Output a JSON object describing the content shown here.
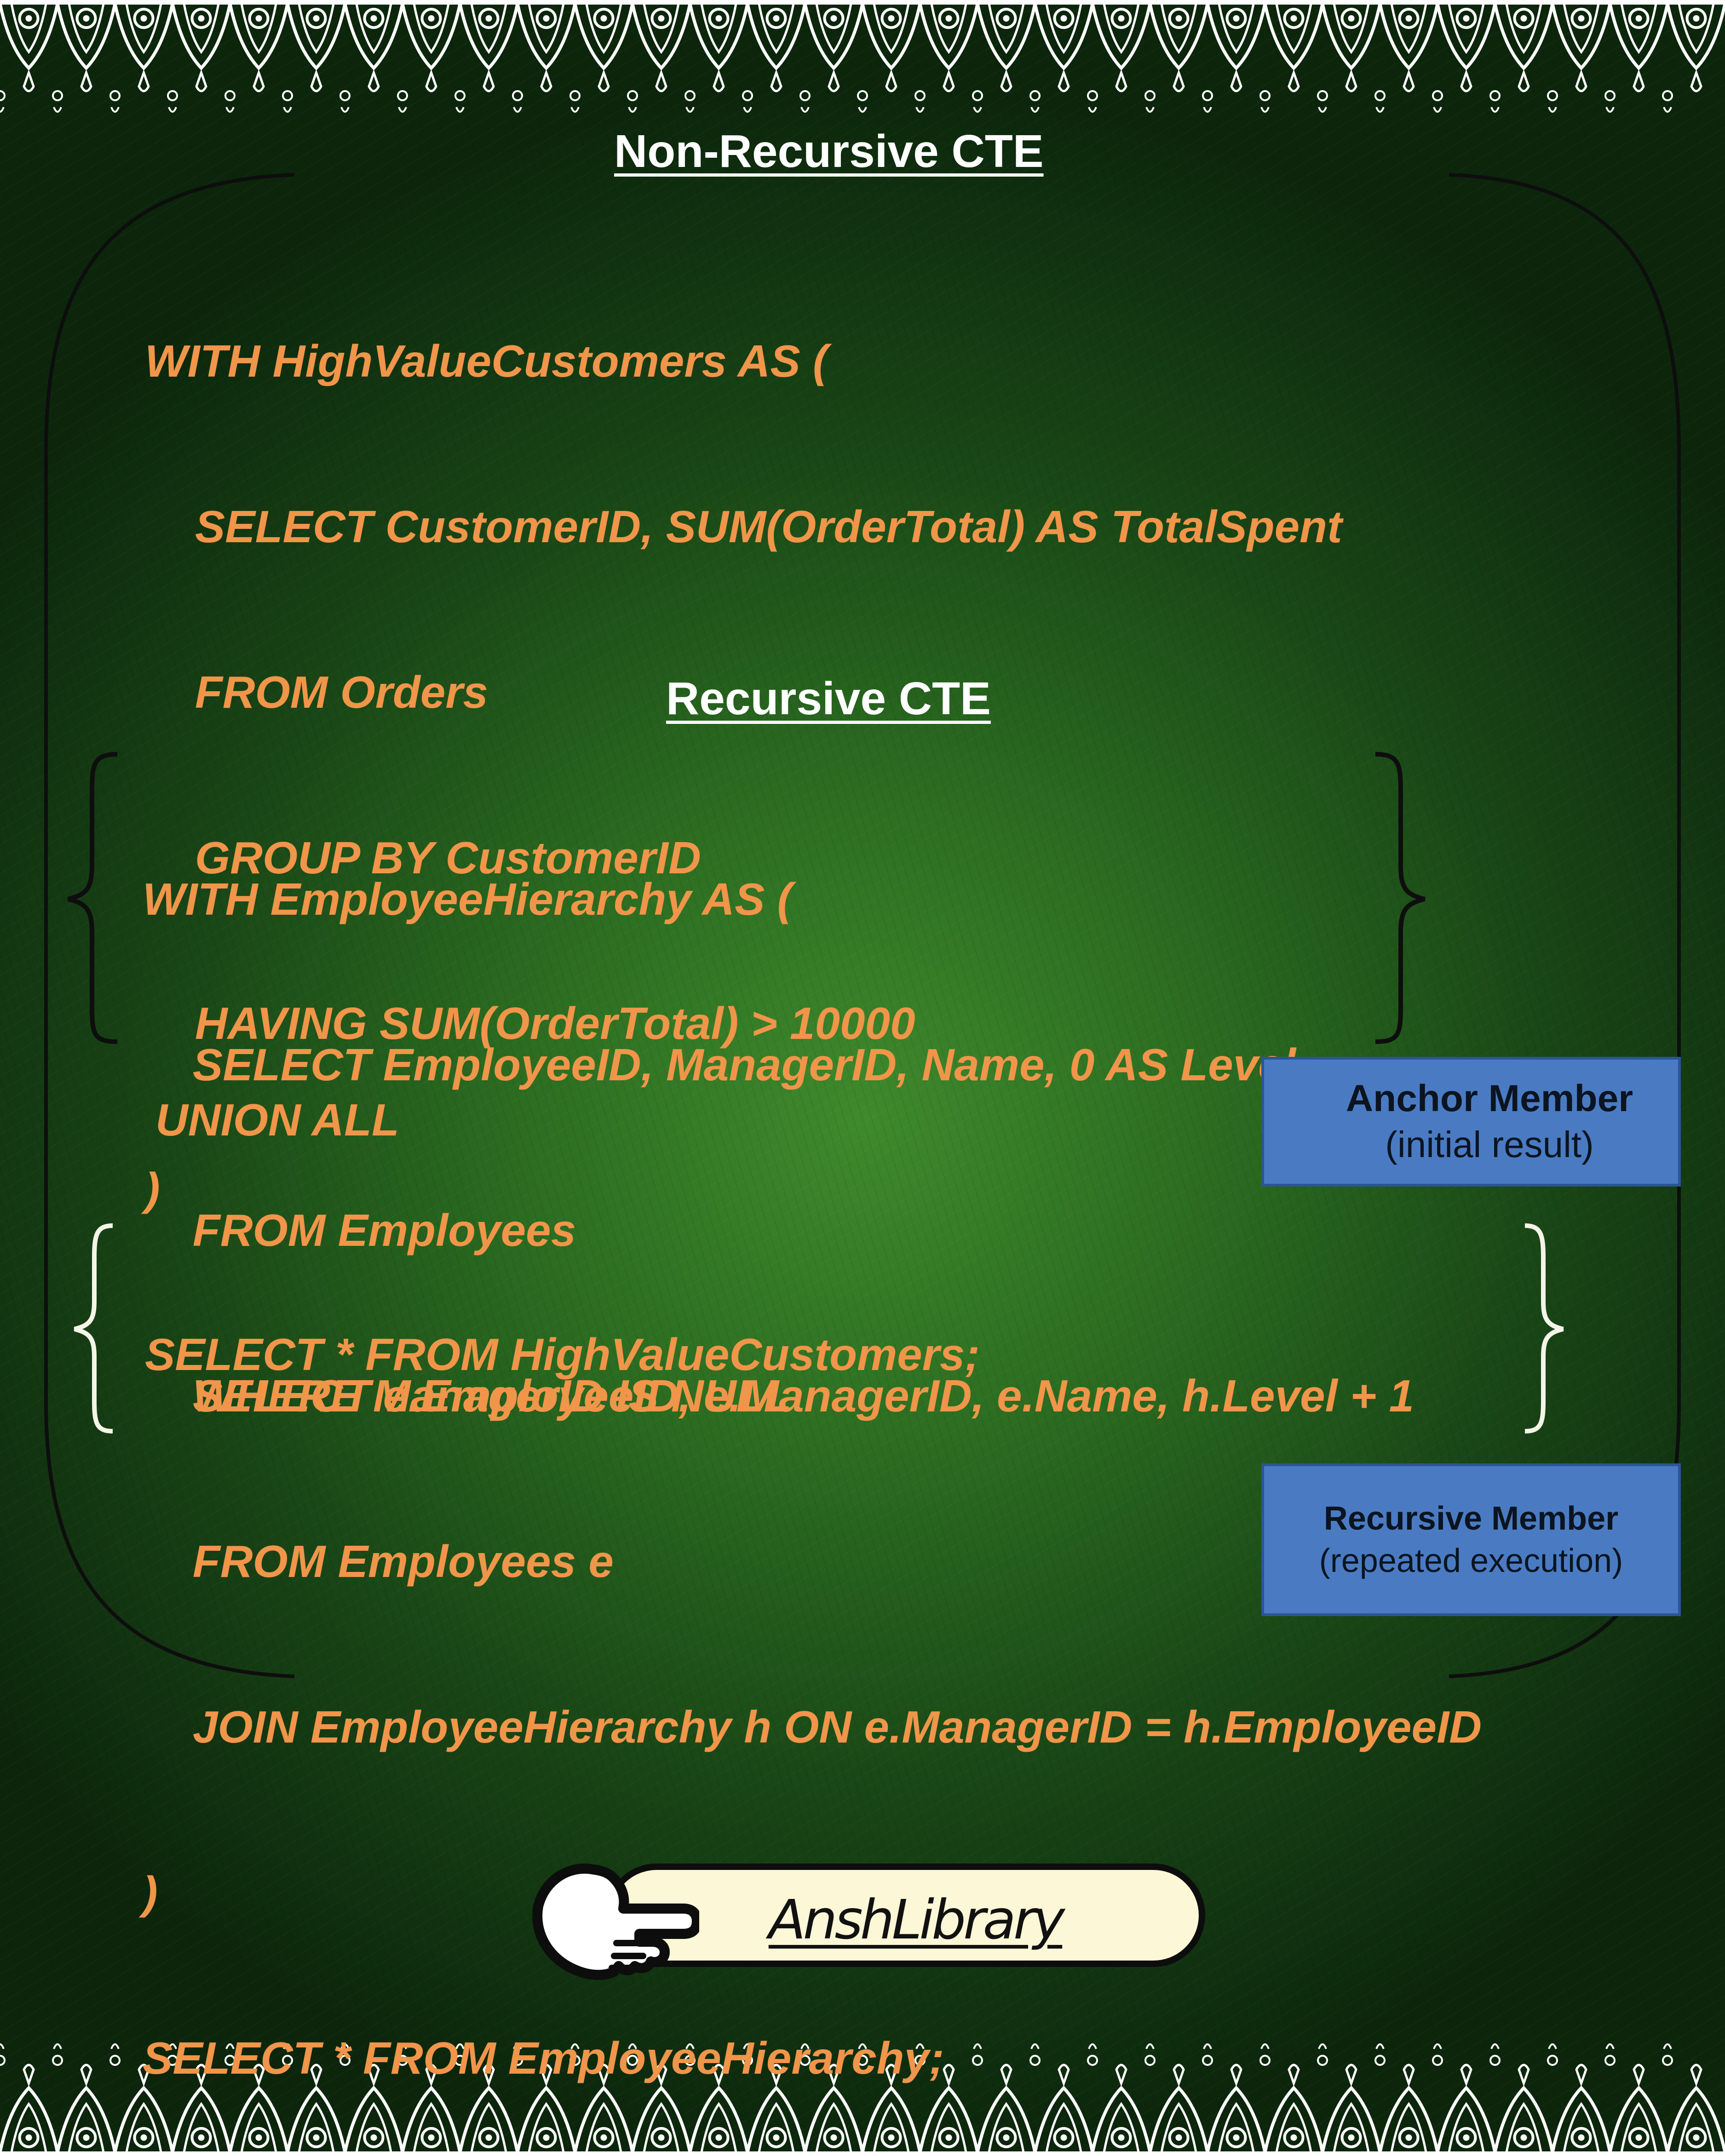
{
  "non_recursive": {
    "heading": "Non-Recursive CTE",
    "lines": [
      "WITH HighValueCustomers AS (",
      "    SELECT CustomerID, SUM(OrderTotal) AS TotalSpent",
      "    FROM Orders",
      "    GROUP BY CustomerID",
      "    HAVING SUM(OrderTotal) > 10000",
      ")",
      "SELECT * FROM HighValueCustomers;"
    ]
  },
  "recursive": {
    "heading": "Recursive CTE",
    "anchor_lines": [
      "WITH EmployeeHierarchy AS (",
      "    SELECT EmployeeID, ManagerID, Name, 0 AS Level",
      "    FROM Employees",
      "    WHERE ManagerID IS NULL"
    ],
    "union": "UNION ALL",
    "recursive_lines": [
      "    SELECT e.EmployeeID, e.ManagerID, e.Name, h.Level + 1",
      "    FROM Employees e",
      "    JOIN EmployeeHierarchy h ON e.ManagerID = h.EmployeeID",
      ")",
      "SELECT * FROM EmployeeHierarchy;"
    ]
  },
  "callouts": {
    "anchor": {
      "title": "Anchor Member",
      "subtitle": "(initial result)"
    },
    "recursive": {
      "title": "Recursive Member",
      "subtitle": "(repeated execution)"
    }
  },
  "brand": {
    "name": "AnshLibrary",
    "icon": "pointing-hand-icon"
  },
  "colors": {
    "code": "#f0954a",
    "heading": "#ffffff",
    "callout_fill": "#4a7bc2",
    "background": "#2a6a20",
    "pill": "#fcf7d6"
  }
}
